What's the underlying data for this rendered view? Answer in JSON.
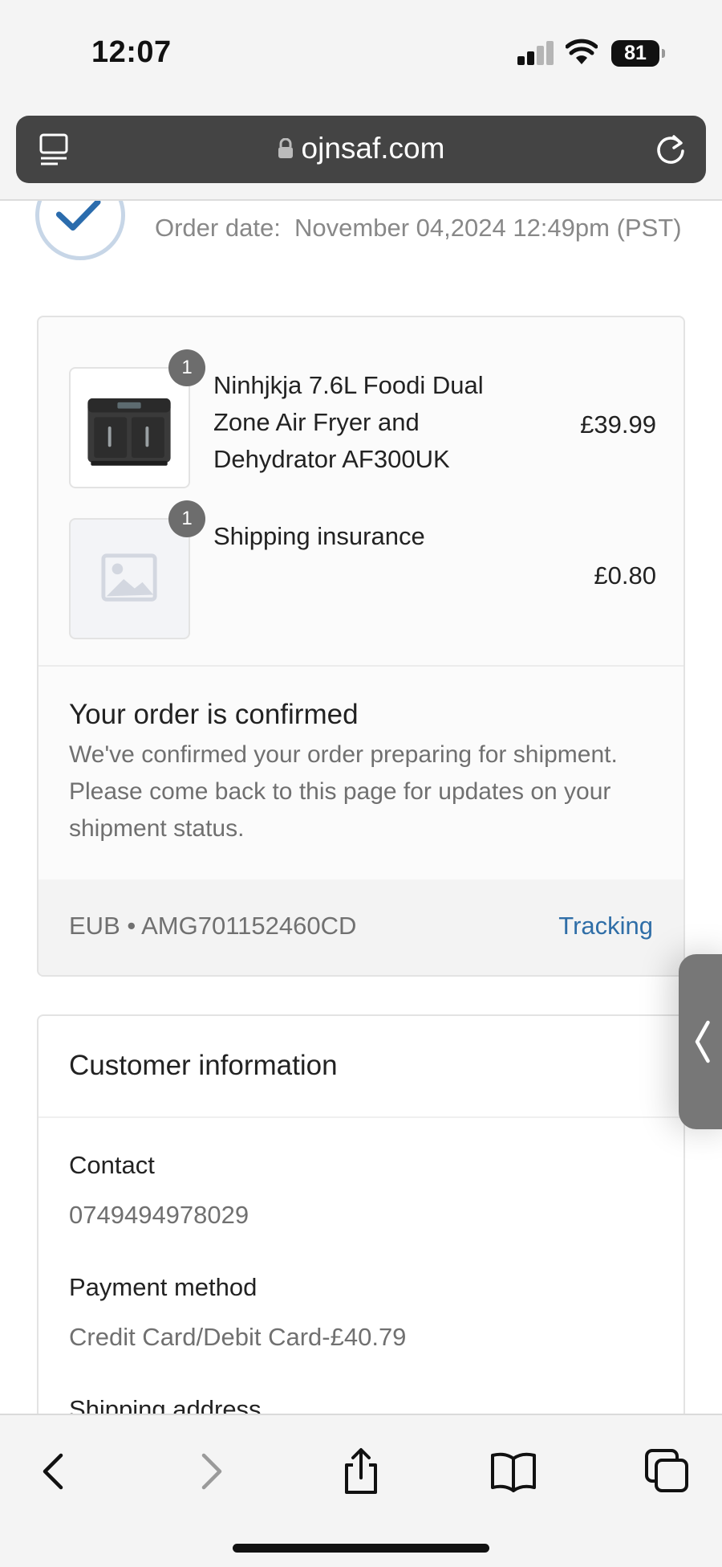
{
  "status_bar": {
    "time": "12:07",
    "battery": "81"
  },
  "browser": {
    "url": "ojnsaf.com"
  },
  "order": {
    "date_label": "Order date:",
    "date_value": "November 04,2024 12:49pm (PST)",
    "items": [
      {
        "name": "Ninhjkja 7.6L Foodi Dual Zone Air Fryer and Dehydrator AF300UK",
        "price": "£39.99",
        "quantity": "1"
      },
      {
        "name": "Shipping insurance",
        "price": "£0.80",
        "quantity": "1"
      }
    ],
    "confirmation": {
      "title": "Your order is confirmed",
      "text": "We've confirmed your order preparing for shipment. Please come back to this page for updates on your shipment status."
    },
    "tracking": {
      "code": "EUB • AMG701152460CD",
      "link_label": "Tracking"
    }
  },
  "customer": {
    "title": "Customer information",
    "contact_label": "Contact",
    "contact_value": "0749494978029",
    "payment_label": "Payment method",
    "payment_value": "Credit Card/Debit Card-£40.79",
    "shipping_label": "Shipping address"
  },
  "colors": {
    "accent": "#2f6ea7",
    "checkmark": "#2b6cad",
    "url_bar": "#444444"
  }
}
